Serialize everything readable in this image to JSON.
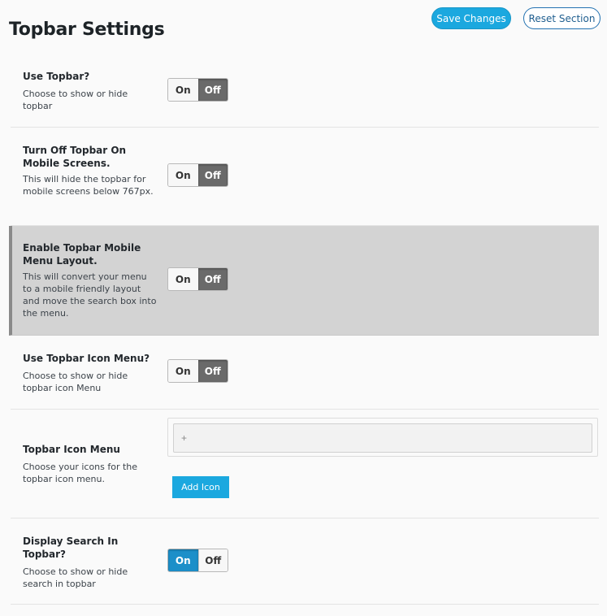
{
  "header": {
    "title": "Topbar Settings",
    "save_label": "Save Changes",
    "reset_label": "Reset Section"
  },
  "settings": [
    {
      "title": "Use Topbar?",
      "desc": "Choose to show or hide topbar",
      "on_label": "On",
      "off_label": "Off",
      "state": "off"
    },
    {
      "title": "Turn Off Topbar On Mobile Screens.",
      "desc": "This will hide the topbar for mobile screens below 767px.",
      "on_label": "On",
      "off_label": "Off",
      "state": "off"
    },
    {
      "title": "Enable Topbar Mobile Menu Layout.",
      "desc": "This will convert your menu to a mobile friendly layout and move the search box into the menu.",
      "on_label": "On",
      "off_label": "Off",
      "state": "off"
    },
    {
      "title": "Use Topbar Icon Menu?",
      "desc": "Choose to show or hide topbar icon Menu",
      "on_label": "On",
      "off_label": "Off",
      "state": "off"
    },
    {
      "title": "Topbar Icon Menu",
      "desc": "Choose your icons for the topbar icon menu.",
      "add_label": "Add Icon",
      "plus_glyph": "+"
    },
    {
      "title": "Display Search In Topbar?",
      "desc": "Choose to show or hide search in topbar",
      "on_label": "On",
      "off_label": "Off",
      "state": "on"
    }
  ]
}
